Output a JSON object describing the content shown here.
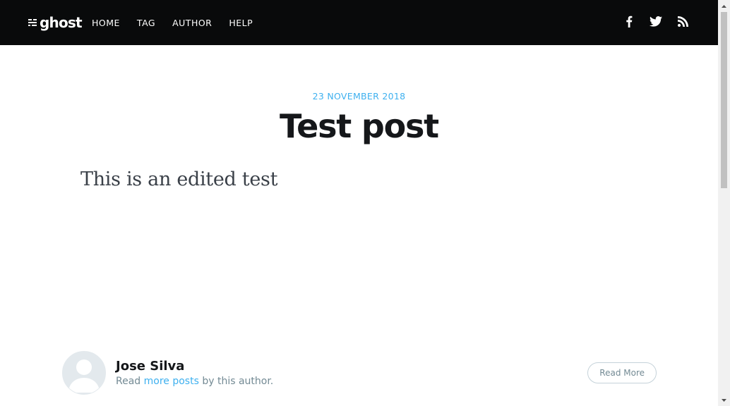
{
  "nav": {
    "logo_text": "ghost",
    "items": [
      {
        "label": "HOME"
      },
      {
        "label": "TAG"
      },
      {
        "label": "AUTHOR"
      },
      {
        "label": "HELP"
      }
    ],
    "social": [
      {
        "icon": "facebook-icon"
      },
      {
        "icon": "twitter-icon"
      },
      {
        "icon": "rss-icon"
      }
    ]
  },
  "post": {
    "date": "23 NOVEMBER 2018",
    "title": "Test post",
    "body": "This is an edited test"
  },
  "author": {
    "name": "Jose Silva",
    "bio_prefix": "Read ",
    "bio_link": "more posts",
    "bio_suffix": " by this author.",
    "read_more_label": "Read More"
  },
  "colors": {
    "accent": "#3eb0ef",
    "navbar": "#090a0b",
    "title": "#15171a",
    "muted": "#738a94"
  }
}
